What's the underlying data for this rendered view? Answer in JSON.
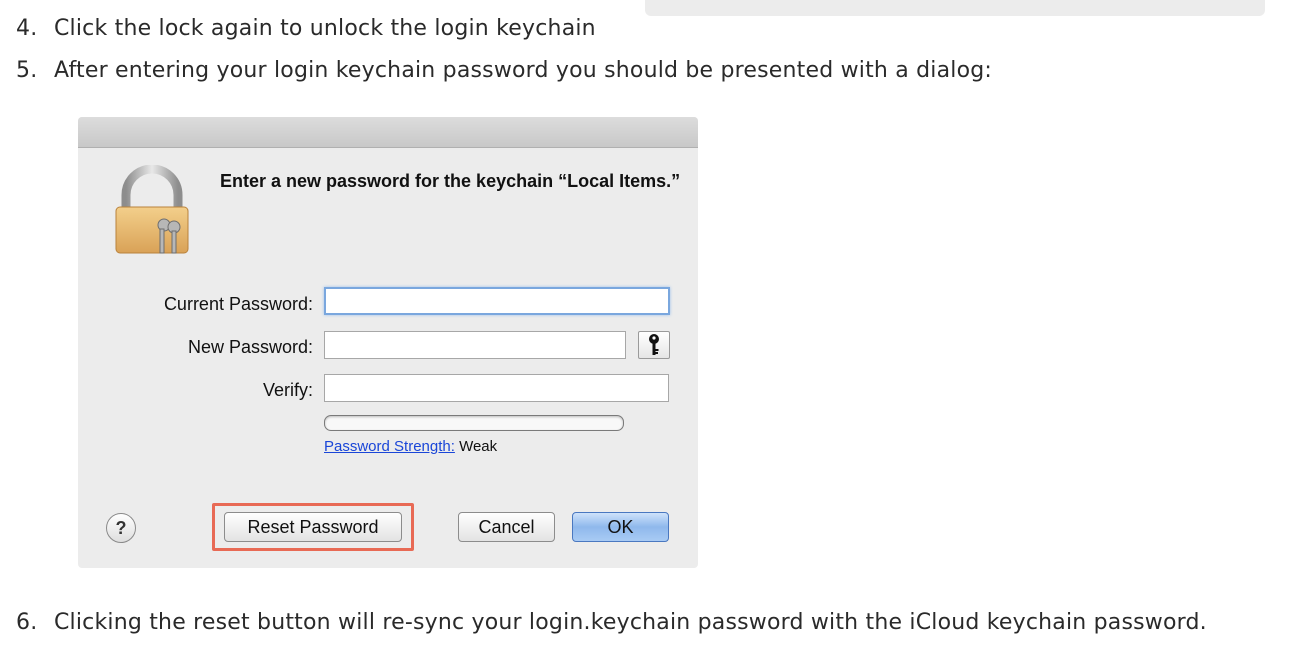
{
  "steps": [
    {
      "num": "4.",
      "text": "Click the lock again to unlock the login keychain"
    },
    {
      "num": "5.",
      "text": "After entering your login keychain password you should be presented with a dialog:"
    },
    {
      "num": "6.",
      "text": "Clicking the reset button will re-sync your login.keychain password with the iCloud keychain password."
    }
  ],
  "dialog": {
    "prompt": "Enter a new password for the keychain “Local Items.”",
    "labels": {
      "current": "Current Password:",
      "new": "New Password:",
      "verify": "Verify:"
    },
    "fields": {
      "current": "",
      "new": "",
      "verify": ""
    },
    "strength": {
      "label": "Password Strength:",
      "value": "Weak",
      "level": 0
    },
    "buttons": {
      "help": "?",
      "reset": "Reset Password",
      "cancel": "Cancel",
      "ok": "OK"
    },
    "highlight_color": "#e86a55",
    "accent": "#7aa7de"
  },
  "icons": {
    "lock": "lock-keys-icon",
    "key": "key-icon",
    "help": "help-icon"
  }
}
